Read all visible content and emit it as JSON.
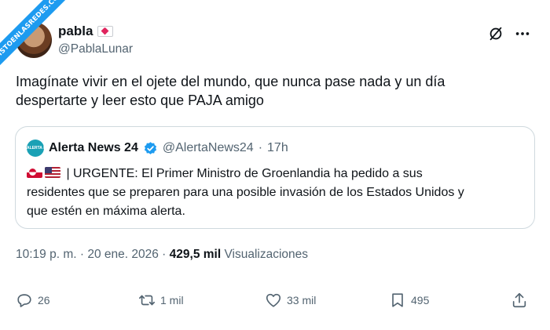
{
  "watermark": "VISTOENLASREDES.COM",
  "author": {
    "name": "pabla",
    "emoji": "love-letter-icon",
    "handle": "@PablaLunar"
  },
  "header_icons": [
    "grok-icon",
    "more-icon"
  ],
  "tweet": {
    "text_line1": "Imagínate vivir en el ojete del mundo, que nunca pase nada y un día",
    "text_line2": "despertarte y leer esto que PAJA amigo"
  },
  "quote": {
    "avatar_text": "ALERTA NEWS",
    "name": "Alerta News 24",
    "handle": "@AlertaNews24",
    "separator": "·",
    "time": "17h",
    "text_line1": "| URGENTE: El Primer Ministro de Groenlandia ha pedido a sus",
    "text_line2": "residentes que se preparen para una posible invasión de los Estados Unidos y",
    "text_line3": "que estén en máxima alerta."
  },
  "meta": {
    "time": "10:19 p. m.",
    "sep1": "·",
    "date": "20 ene. 2026",
    "sep2": "·",
    "views_count": "429,5 mil",
    "views_label": "Visualizaciones"
  },
  "actions": {
    "replies": "26",
    "retweets": "1 mil",
    "likes": "33 mil",
    "bookmarks": "495"
  },
  "colors": {
    "verified": "#1d9bf0",
    "text_secondary": "#536471",
    "border": "#cfd9de"
  }
}
